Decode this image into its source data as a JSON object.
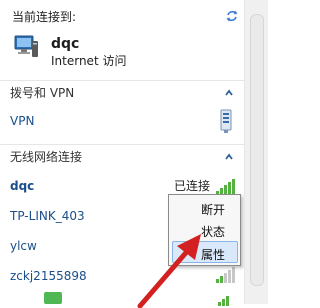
{
  "header": {
    "label": "当前连接到:",
    "network_name": "dqc",
    "network_status": "Internet 访问"
  },
  "sections": {
    "dialup": {
      "title": "拨号和 VPN",
      "items": [
        {
          "label": "VPN"
        }
      ]
    },
    "wireless": {
      "title": "无线网络连接",
      "items": [
        {
          "label": "dqc",
          "status": "已连接"
        },
        {
          "label": "TP-LINK_403"
        },
        {
          "label": "ylcw"
        },
        {
          "label": "zckj2155898"
        }
      ]
    }
  },
  "context_menu": {
    "items": [
      {
        "label": "断开"
      },
      {
        "label": "状态"
      },
      {
        "label": "属性"
      }
    ],
    "highlighted_index": 2
  },
  "icons": {
    "refresh": "refresh-icon",
    "computer": "computer-icon",
    "vpn": "vpn-icon",
    "signal": "signal-bars-icon",
    "chevron": "chevron-up-icon"
  },
  "colors": {
    "link": "#1a4f8a",
    "signal": "#55b241",
    "menu_highlight": "#d9e8fb",
    "arrow": "#d32020"
  }
}
